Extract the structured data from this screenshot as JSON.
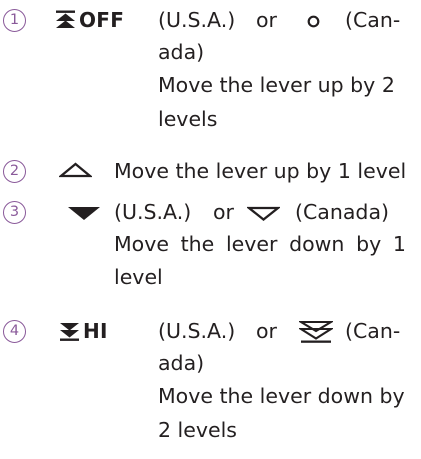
{
  "items": [
    {
      "number": "1",
      "icon_name": "lever-up-two-levels-icon",
      "icon_label": "OFF",
      "region_usa": "(U.S.A.)",
      "or_text": "or",
      "canada_icon_name": "small-circle-icon",
      "region_canada_1": "(Can-",
      "region_canada_2": "ada)",
      "desc_lines": [
        "Move the lever up by 2",
        "levels"
      ]
    },
    {
      "number": "2",
      "icon_name": "outline-up-triangle-icon",
      "desc": "Move the lever up by 1 level"
    },
    {
      "number": "3",
      "icon_name": "solid-down-triangle-icon",
      "region_usa": "(U.S.A.)",
      "or_text": "or",
      "canada_icon_name": "outline-down-triangle-icon",
      "region_canada": "(Canada)",
      "desc_words": [
        "Move",
        "the",
        "lever",
        "down",
        "by",
        "1"
      ],
      "desc_last": "level"
    },
    {
      "number": "4",
      "icon_name": "lever-down-two-levels-icon",
      "icon_label": "HI",
      "region_usa": "(U.S.A.)",
      "or_text": "or",
      "canada_icon_name": "outline-double-down-triangle-icon",
      "region_canada_1": "(Can-",
      "region_canada_2": "ada)",
      "desc_lines": [
        "Move the lever down by",
        "2 levels"
      ]
    }
  ]
}
